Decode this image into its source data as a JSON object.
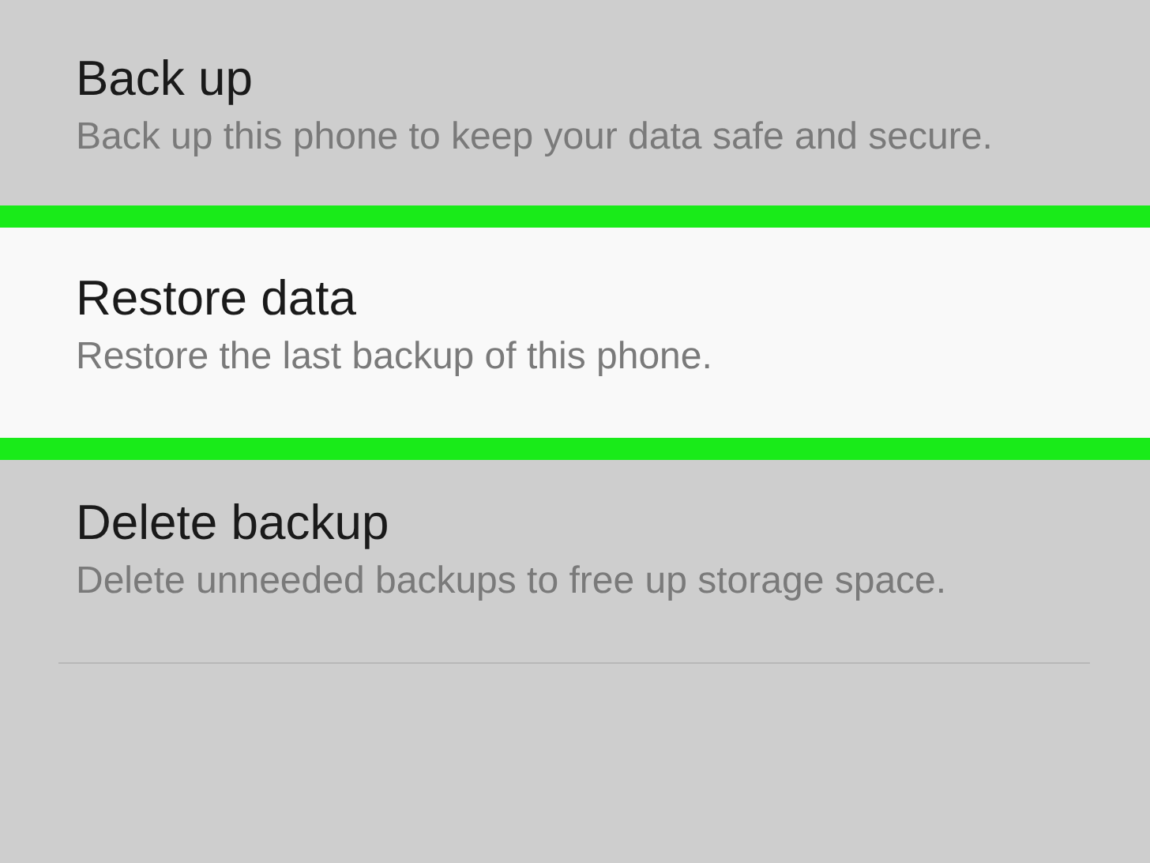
{
  "items": [
    {
      "title": "Back up",
      "subtitle": "Back up this phone to keep your data safe and secure.",
      "highlighted": false
    },
    {
      "title": "Restore data",
      "subtitle": "Restore the last backup of this phone.",
      "highlighted": true
    },
    {
      "title": "Delete backup",
      "subtitle": "Delete unneeded backups to free up storage space.",
      "highlighted": false
    }
  ]
}
